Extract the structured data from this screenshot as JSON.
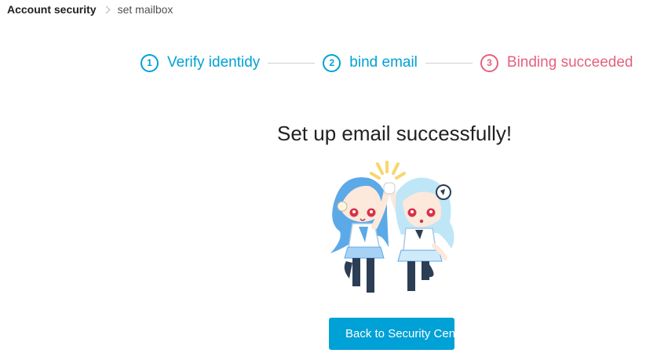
{
  "breadcrumb": {
    "root": "Account security",
    "current": "set mailbox"
  },
  "steps": [
    {
      "number": "1",
      "label": "Verify identidy",
      "color": "#00a1d6"
    },
    {
      "number": "2",
      "label": "bind email",
      "color": "#00a1d6"
    },
    {
      "number": "3",
      "label": "Binding succeeded",
      "color": "#e5617e"
    }
  ],
  "main": {
    "title": "Set up email successfully!",
    "illustration": "two-chibi-characters-high-five",
    "back_button_label": "Back to Security Center"
  },
  "colors": {
    "accent": "#00a1d6",
    "active_step": "#e5617e",
    "text": "#212121"
  }
}
